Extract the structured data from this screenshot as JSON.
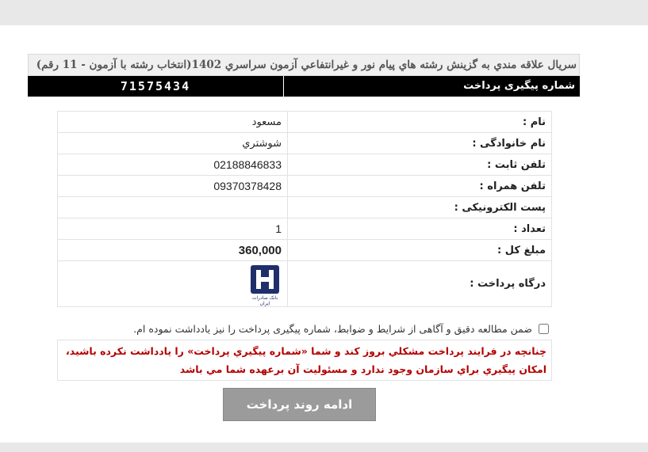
{
  "header": {
    "title": "سريال علاقه مندي به گزينش رشته هاي پيام نور و غيرانتفاعي آزمون سراسري 1402(انتخاب رشته با آزمون - 11 رقم)"
  },
  "tracking": {
    "label": "شماره پیگیری پرداخت",
    "code": "71575434"
  },
  "fields": [
    {
      "label": "نام :",
      "value": "مسعود"
    },
    {
      "label": "نام خانوادگی :",
      "value": "شوشتري"
    },
    {
      "label": "تلفن ثابت :",
      "value": "02188846833"
    },
    {
      "label": "تلفن همراه :",
      "value": "09370378428"
    },
    {
      "label": "پست الکترونیکی :",
      "value": ""
    },
    {
      "label": "تعداد :",
      "value": "1"
    },
    {
      "label": "مبلغ کل :",
      "value": "360,000"
    },
    {
      "label": "درگاه پرداخت :",
      "value": ""
    }
  ],
  "gateway": {
    "logo_icon": "bank-saderat-logo",
    "logo_caption": "بانک صادرات ایران",
    "logo_color": "#1f2f6b"
  },
  "terms": {
    "label": "ضمن مطالعه دقیق و آگاهی از شرایط و ضوابط، شماره پیگیری پرداخت را نیز یادداشت نموده ام.",
    "checked": false
  },
  "warning": {
    "text": "چنانچه در فرایند پرداخت مشکلي بروز کند و شما «شماره پيگيري پرداخت» را يادداشت نکرده باشيد، امکان پيگيري براي سازمان وجود ندارد و مسئوليت آن برعهده شما مي باشد",
    "color": "#b30000"
  },
  "actions": {
    "submit_label": "ادامه روند پرداخت"
  }
}
